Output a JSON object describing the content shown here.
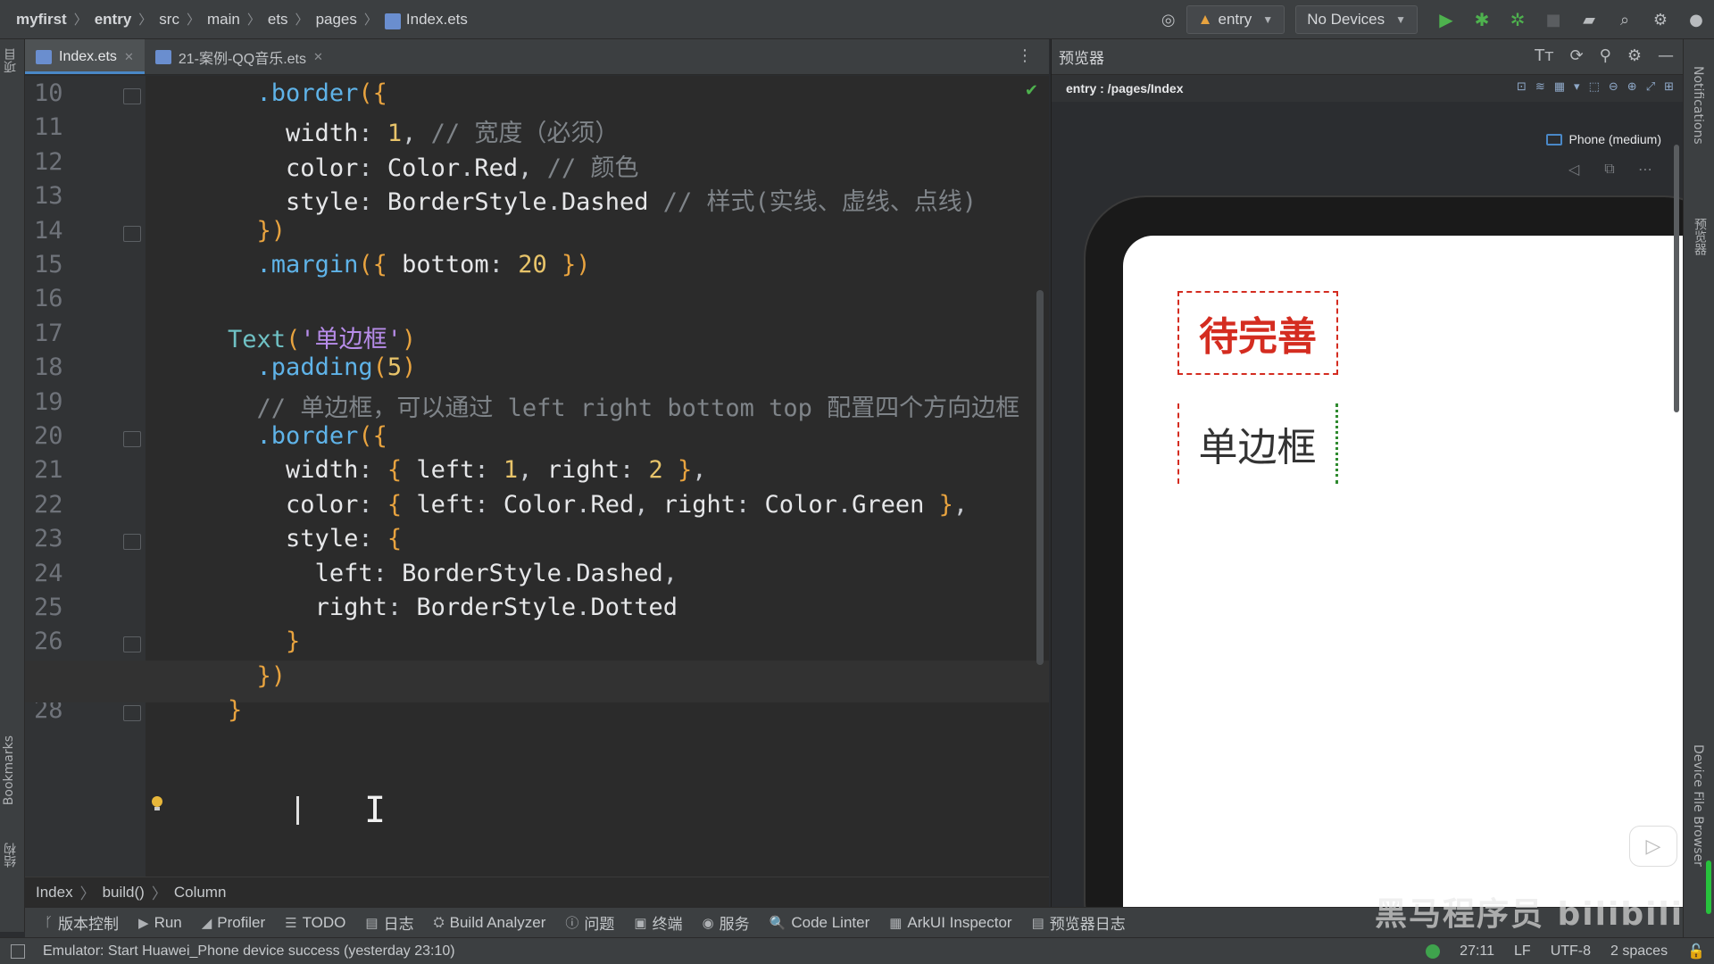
{
  "titlebar": {
    "breadcrumbs": [
      "myfirst",
      "entry",
      "src",
      "main",
      "ets",
      "pages",
      "Index.ets"
    ],
    "module_select": "entry",
    "device_select": "No Devices"
  },
  "left_strip": {
    "project_label": "项目",
    "bookmarks_label": "Bookmarks",
    "structure_label": "结构"
  },
  "tabs": [
    {
      "label": "Index.ets",
      "active": true
    },
    {
      "label": "21-案例-QQ音乐.ets",
      "active": false
    }
  ],
  "editor": {
    "current_line": 27,
    "lines": [
      {
        "n": "10",
        "tokens": [
          [
            "pun",
            "      "
          ],
          [
            "meth",
            ".border"
          ],
          [
            "brk",
            "({"
          ]
        ]
      },
      {
        "n": "11",
        "tokens": [
          [
            "pun",
            "        "
          ],
          [
            "prop",
            "width"
          ],
          [
            "pun",
            ": "
          ],
          [
            "num",
            "1"
          ],
          [
            "pun",
            ", "
          ],
          [
            "cmt",
            "// 宽度（必须）"
          ]
        ]
      },
      {
        "n": "12",
        "tokens": [
          [
            "pun",
            "        "
          ],
          [
            "prop",
            "color"
          ],
          [
            "pun",
            ": "
          ],
          [
            "prop",
            "Color"
          ],
          [
            "pun",
            "."
          ],
          [
            "prop",
            "Red"
          ],
          [
            "pun",
            ", "
          ],
          [
            "cmt",
            "// 颜色"
          ]
        ]
      },
      {
        "n": "13",
        "tokens": [
          [
            "pun",
            "        "
          ],
          [
            "prop",
            "style"
          ],
          [
            "pun",
            ": "
          ],
          [
            "prop",
            "BorderStyle"
          ],
          [
            "pun",
            "."
          ],
          [
            "prop",
            "Dashed"
          ],
          [
            "pun",
            " "
          ],
          [
            "cmt",
            "// 样式(实线、虚线、点线)"
          ]
        ]
      },
      {
        "n": "14",
        "tokens": [
          [
            "pun",
            "      "
          ],
          [
            "brk",
            "})"
          ]
        ]
      },
      {
        "n": "15",
        "tokens": [
          [
            "pun",
            "      "
          ],
          [
            "meth",
            ".margin"
          ],
          [
            "brk",
            "({ "
          ],
          [
            "prop",
            "bottom"
          ],
          [
            "pun",
            ": "
          ],
          [
            "num",
            "20"
          ],
          [
            "brk",
            " })"
          ]
        ]
      },
      {
        "n": "16",
        "tokens": []
      },
      {
        "n": "17",
        "tokens": [
          [
            "pun",
            "    "
          ],
          [
            "type",
            "Text"
          ],
          [
            "brk",
            "("
          ],
          [
            "str",
            "'单边框'"
          ],
          [
            "brk",
            ")"
          ]
        ]
      },
      {
        "n": "18",
        "tokens": [
          [
            "pun",
            "      "
          ],
          [
            "meth",
            ".padding"
          ],
          [
            "brk",
            "("
          ],
          [
            "num",
            "5"
          ],
          [
            "brk",
            ")"
          ]
        ]
      },
      {
        "n": "19",
        "tokens": [
          [
            "pun",
            "      "
          ],
          [
            "cmt",
            "// 单边框，可以通过 left right bottom top 配置四个方向边框"
          ]
        ]
      },
      {
        "n": "20",
        "tokens": [
          [
            "pun",
            "      "
          ],
          [
            "meth",
            ".border"
          ],
          [
            "brk",
            "({"
          ]
        ]
      },
      {
        "n": "21",
        "tokens": [
          [
            "pun",
            "        "
          ],
          [
            "prop",
            "width"
          ],
          [
            "pun",
            ": "
          ],
          [
            "brk",
            "{ "
          ],
          [
            "prop",
            "left"
          ],
          [
            "pun",
            ": "
          ],
          [
            "num",
            "1"
          ],
          [
            "pun",
            ", "
          ],
          [
            "prop",
            "right"
          ],
          [
            "pun",
            ": "
          ],
          [
            "num",
            "2"
          ],
          [
            "brk",
            " }"
          ],
          [
            "pun",
            ","
          ]
        ]
      },
      {
        "n": "22",
        "tokens": [
          [
            "pun",
            "        "
          ],
          [
            "prop",
            "color"
          ],
          [
            "pun",
            ": "
          ],
          [
            "brk",
            "{ "
          ],
          [
            "prop",
            "left"
          ],
          [
            "pun",
            ": "
          ],
          [
            "prop",
            "Color"
          ],
          [
            "pun",
            "."
          ],
          [
            "prop",
            "Red"
          ],
          [
            "pun",
            ", "
          ],
          [
            "prop",
            "right"
          ],
          [
            "pun",
            ": "
          ],
          [
            "prop",
            "Color"
          ],
          [
            "pun",
            "."
          ],
          [
            "prop",
            "Green"
          ],
          [
            "brk",
            " }"
          ],
          [
            "pun",
            ","
          ]
        ]
      },
      {
        "n": "23",
        "tokens": [
          [
            "pun",
            "        "
          ],
          [
            "prop",
            "style"
          ],
          [
            "pun",
            ": "
          ],
          [
            "brk",
            "{"
          ]
        ]
      },
      {
        "n": "24",
        "tokens": [
          [
            "pun",
            "          "
          ],
          [
            "prop",
            "left"
          ],
          [
            "pun",
            ": "
          ],
          [
            "prop",
            "BorderStyle"
          ],
          [
            "pun",
            "."
          ],
          [
            "prop",
            "Dashed"
          ],
          [
            "pun",
            ","
          ]
        ]
      },
      {
        "n": "25",
        "tokens": [
          [
            "pun",
            "          "
          ],
          [
            "prop",
            "right"
          ],
          [
            "pun",
            ": "
          ],
          [
            "prop",
            "BorderStyle"
          ],
          [
            "pun",
            "."
          ],
          [
            "prop",
            "Dotted"
          ]
        ]
      },
      {
        "n": "26",
        "tokens": [
          [
            "pun",
            "        "
          ],
          [
            "brk",
            "}"
          ]
        ]
      },
      {
        "n": "27",
        "tokens": [
          [
            "pun",
            "      "
          ],
          [
            "brk",
            "})"
          ]
        ]
      },
      {
        "n": "28",
        "tokens": [
          [
            "pun",
            "    "
          ],
          [
            "brk",
            "}"
          ]
        ]
      }
    ]
  },
  "code_crumbs": [
    "Index",
    "build()",
    "Column"
  ],
  "tool_windows": [
    {
      "icon": "git-branch-icon",
      "glyph": "ᚴ",
      "label": "版本控制"
    },
    {
      "icon": "run-icon",
      "glyph": "▶",
      "label": "Run"
    },
    {
      "icon": "profiler-icon",
      "glyph": "◢",
      "label": "Profiler"
    },
    {
      "icon": "todo-icon",
      "glyph": "☰",
      "label": "TODO"
    },
    {
      "icon": "log-icon",
      "glyph": "▤",
      "label": "日志"
    },
    {
      "icon": "build-analyzer-icon",
      "glyph": "⛭",
      "label": "Build Analyzer"
    },
    {
      "icon": "problems-icon",
      "glyph": "ⓘ",
      "label": "问题"
    },
    {
      "icon": "terminal-icon",
      "glyph": "▣",
      "label": "终端"
    },
    {
      "icon": "services-icon",
      "glyph": "◉",
      "label": "服务"
    },
    {
      "icon": "code-linter-icon",
      "glyph": "🔍",
      "label": "Code Linter"
    },
    {
      "icon": "arkui-inspector-icon",
      "glyph": "▦",
      "label": "ArkUI Inspector"
    },
    {
      "icon": "previewer-log-icon",
      "glyph": "▤",
      "label": "预览器日志"
    }
  ],
  "status": {
    "message": "Emulator: Start Huawei_Phone device success (yesterday 23:10)",
    "position": "27:11",
    "line_sep": "LF",
    "encoding": "UTF-8",
    "indent": "2 spaces"
  },
  "preview": {
    "title": "预览器",
    "path": "entry : /pages/Index",
    "device": "Phone (medium)",
    "texts": {
      "t1": "待完善",
      "t2": "单边框"
    }
  },
  "right_strip": {
    "notifications_label": "Notifications",
    "previewer_label": "预览器",
    "device_file_label": "Device File Browser"
  },
  "watermark": "黑马程序员 bilibili"
}
